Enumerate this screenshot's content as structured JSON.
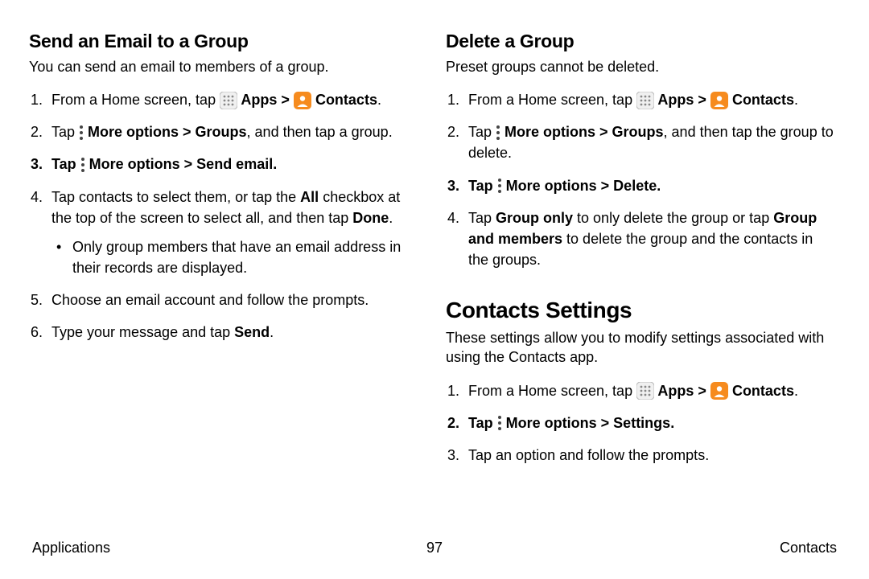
{
  "left": {
    "heading": "Send an Email to a Group",
    "lead": "You can send an email to members of a group.",
    "step1_a": "From a Home screen, tap ",
    "step1_apps": " Apps > ",
    "step1_contacts": " Contacts",
    "step2_a": "Tap ",
    "step2_b": " More options > Groups",
    "step2_c": ", and then tap a group.",
    "step3_a": "Tap ",
    "step3_b": " More options > Send email",
    "step4_a": "Tap contacts to select them, or tap the ",
    "step4_all": "All",
    "step4_b": " checkbox at the top of the screen to select all, and then tap ",
    "step4_done": "Done",
    "bullet": "Only group members that have an email address in their records are displayed.",
    "step5": "Choose an email account and follow the prompts.",
    "step6_a": "Type your message and tap ",
    "step6_send": "Send"
  },
  "right": {
    "del_heading": "Delete a Group",
    "del_lead": "Preset groups cannot be deleted.",
    "d1_a": "From a Home screen, tap ",
    "d1_apps": " Apps > ",
    "d1_contacts": " Contacts",
    "d2_a": "Tap ",
    "d2_b": " More options > Groups",
    "d2_c": ", and then tap the group to delete.",
    "d3_a": "Tap ",
    "d3_b": " More options > Delete",
    "d4_a": "Tap ",
    "d4_go": "Group only",
    "d4_b": " to only delete the group or tap ",
    "d4_gm": "Group and members",
    "d4_c": " to delete the group and the contacts in the groups.",
    "cs_heading": "Contacts Settings",
    "cs_lead": "These settings allow you to modify settings associated with using the Contacts app.",
    "c1_a": "From a Home screen, tap ",
    "c1_apps": " Apps > ",
    "c1_contacts": " Contacts",
    "c2_a": "Tap ",
    "c2_b": " More options > Settings",
    "c3": "Tap an option and follow the prompts."
  },
  "footer": {
    "left": "Applications",
    "center": "97",
    "right": "Contacts"
  }
}
